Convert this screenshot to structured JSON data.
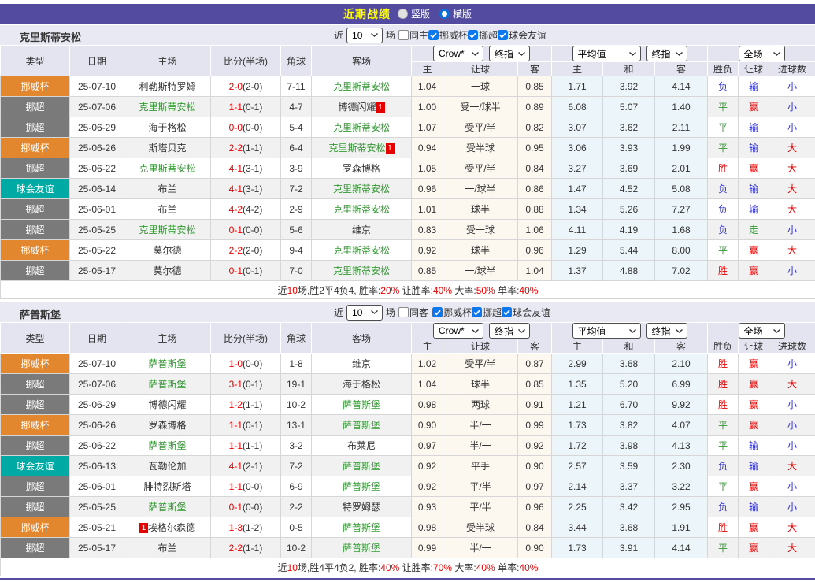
{
  "page": {
    "title": "近期战绩",
    "layout_options": [
      {
        "label": "竖版",
        "selected": false
      },
      {
        "label": "横版",
        "selected": true
      }
    ]
  },
  "filter": {
    "near": "近",
    "rounds": "10",
    "unit": "场"
  },
  "header": {
    "type": "类型",
    "date": "日期",
    "home": "主场",
    "score": "比分(半场)",
    "corners": "角球",
    "away": "客场",
    "group1_selects": [
      "Crow*",
      "终指"
    ],
    "group1_cols": [
      "主",
      "让球",
      "客"
    ],
    "group2_selects": [
      "平均值",
      "终指"
    ],
    "group2_cols": [
      "主",
      "和",
      "客"
    ],
    "group3_select": "全场",
    "group3_cols": [
      "胜负",
      "让球",
      "进球数"
    ]
  },
  "type_colors": {
    "挪威杯": "#e2872e",
    "挪超": "#7a7a7a",
    "球会友谊": "#00aaa4"
  },
  "result_colors": {
    "胜": "r-red",
    "平": "r-green",
    "负": "r-blue",
    "赢": "r-red",
    "输": "r-blue",
    "走": "r-green",
    "大": "r-red",
    "小": "r-blue"
  },
  "select_widths": {
    "rounds-select": 46,
    "bookmaker-select": 64,
    "index-type-select": 52,
    "average-select": 87,
    "index-type-select-2": 52,
    "period-select": 59
  },
  "tables": [
    {
      "team": "克里斯蒂安松",
      "same_option": "同主",
      "same_checked": false,
      "same_gap": false,
      "competitions": [
        {
          "label": "挪威杯",
          "checked": true
        },
        {
          "label": "挪超",
          "checked": true
        },
        {
          "label": "球会友谊",
          "checked": true
        }
      ],
      "rows": [
        {
          "type": "挪威杯",
          "date": "25-07-10",
          "home": "利勒斯特罗姆",
          "home_self": false,
          "home_badge": "",
          "score": "2-0",
          "half": "(2-0)",
          "corners": "7-11",
          "away": "克里斯蒂安松",
          "away_self": true,
          "away_badge": "",
          "odds": [
            "1.04",
            "一球",
            "0.85"
          ],
          "avg": [
            "1.71",
            "3.92",
            "4.14"
          ],
          "results": [
            "负",
            "输",
            "小"
          ]
        },
        {
          "type": "挪超",
          "date": "25-07-06",
          "home": "克里斯蒂安松",
          "home_self": true,
          "home_badge": "",
          "score": "1-1",
          "half": "(0-1)",
          "corners": "4-7",
          "away": "博德闪耀",
          "away_self": false,
          "away_badge": "1",
          "odds": [
            "1.00",
            "受一/球半",
            "0.89"
          ],
          "avg": [
            "6.08",
            "5.07",
            "1.40"
          ],
          "results": [
            "平",
            "赢",
            "小"
          ]
        },
        {
          "type": "挪超",
          "date": "25-06-29",
          "home": "海于格松",
          "home_self": false,
          "home_badge": "",
          "score": "0-0",
          "half": "(0-0)",
          "corners": "5-4",
          "away": "克里斯蒂安松",
          "away_self": true,
          "away_badge": "",
          "odds": [
            "1.07",
            "受平/半",
            "0.82"
          ],
          "avg": [
            "3.07",
            "3.62",
            "2.11"
          ],
          "results": [
            "平",
            "输",
            "小"
          ]
        },
        {
          "type": "挪威杯",
          "date": "25-06-26",
          "home": "斯塔贝克",
          "home_self": false,
          "home_badge": "",
          "score": "2-2",
          "half": "(1-1)",
          "corners": "6-4",
          "away": "克里斯蒂安松",
          "away_self": true,
          "away_badge": "1",
          "odds": [
            "0.94",
            "受半球",
            "0.95"
          ],
          "avg": [
            "3.06",
            "3.93",
            "1.99"
          ],
          "results": [
            "平",
            "输",
            "大"
          ]
        },
        {
          "type": "挪超",
          "date": "25-06-22",
          "home": "克里斯蒂安松",
          "home_self": true,
          "home_badge": "",
          "score": "4-1",
          "half": "(3-1)",
          "corners": "3-9",
          "away": "罗森博格",
          "away_self": false,
          "away_badge": "",
          "odds": [
            "1.05",
            "受平/半",
            "0.84"
          ],
          "avg": [
            "3.27",
            "3.69",
            "2.01"
          ],
          "results": [
            "胜",
            "赢",
            "大"
          ]
        },
        {
          "type": "球会友谊",
          "date": "25-06-14",
          "home": "布兰",
          "home_self": false,
          "home_badge": "",
          "score": "4-1",
          "half": "(3-1)",
          "corners": "7-2",
          "away": "克里斯蒂安松",
          "away_self": true,
          "away_badge": "",
          "odds": [
            "0.96",
            "一/球半",
            "0.86"
          ],
          "avg": [
            "1.47",
            "4.52",
            "5.08"
          ],
          "results": [
            "负",
            "输",
            "大"
          ]
        },
        {
          "type": "挪超",
          "date": "25-06-01",
          "home": "布兰",
          "home_self": false,
          "home_badge": "",
          "score": "4-2",
          "half": "(4-2)",
          "corners": "2-9",
          "away": "克里斯蒂安松",
          "away_self": true,
          "away_badge": "",
          "odds": [
            "1.01",
            "球半",
            "0.88"
          ],
          "avg": [
            "1.34",
            "5.26",
            "7.27"
          ],
          "results": [
            "负",
            "输",
            "大"
          ]
        },
        {
          "type": "挪超",
          "date": "25-05-25",
          "home": "克里斯蒂安松",
          "home_self": true,
          "home_badge": "",
          "score": "0-1",
          "half": "(0-0)",
          "corners": "5-6",
          "away": "维京",
          "away_self": false,
          "away_badge": "",
          "odds": [
            "0.83",
            "受一球",
            "1.06"
          ],
          "avg": [
            "4.11",
            "4.19",
            "1.68"
          ],
          "results": [
            "负",
            "走",
            "小"
          ]
        },
        {
          "type": "挪威杯",
          "date": "25-05-22",
          "home": "莫尔德",
          "home_self": false,
          "home_badge": "",
          "score": "2-2",
          "half": "(2-0)",
          "corners": "9-4",
          "away": "克里斯蒂安松",
          "away_self": true,
          "away_badge": "",
          "odds": [
            "0.92",
            "球半",
            "0.96"
          ],
          "avg": [
            "1.29",
            "5.44",
            "8.00"
          ],
          "results": [
            "平",
            "赢",
            "大"
          ]
        },
        {
          "type": "挪超",
          "date": "25-05-17",
          "home": "莫尔德",
          "home_self": false,
          "home_badge": "",
          "score": "0-1",
          "half": "(0-1)",
          "corners": "7-0",
          "away": "克里斯蒂安松",
          "away_self": true,
          "away_badge": "",
          "odds": [
            "0.85",
            "一/球半",
            "1.04"
          ],
          "avg": [
            "1.37",
            "4.88",
            "7.02"
          ],
          "results": [
            "胜",
            "赢",
            "小"
          ]
        }
      ],
      "summary": [
        [
          "近",
          0
        ],
        [
          "10",
          1
        ],
        [
          "场,胜2平4负4, 胜率:",
          0
        ],
        [
          "20%",
          1
        ],
        [
          " 让胜率:",
          0
        ],
        [
          "40%",
          1
        ],
        [
          " 大率:",
          0
        ],
        [
          "50%",
          1
        ],
        [
          " 单率:",
          0
        ],
        [
          "40%",
          1
        ]
      ]
    },
    {
      "team": "萨普斯堡",
      "same_option": "同客",
      "same_checked": false,
      "same_gap": true,
      "competitions": [
        {
          "label": "挪威杯",
          "checked": true
        },
        {
          "label": "挪超",
          "checked": true
        },
        {
          "label": "球会友谊",
          "checked": true
        }
      ],
      "rows": [
        {
          "type": "挪威杯",
          "date": "25-07-10",
          "home": "萨普斯堡",
          "home_self": true,
          "home_badge": "",
          "score": "1-0",
          "half": "(0-0)",
          "corners": "1-8",
          "away": "维京",
          "away_self": false,
          "away_badge": "",
          "odds": [
            "1.02",
            "受平/半",
            "0.87"
          ],
          "avg": [
            "2.99",
            "3.68",
            "2.10"
          ],
          "results": [
            "胜",
            "赢",
            "小"
          ]
        },
        {
          "type": "挪超",
          "date": "25-07-06",
          "home": "萨普斯堡",
          "home_self": true,
          "home_badge": "",
          "score": "3-1",
          "half": "(0-1)",
          "corners": "19-1",
          "away": "海于格松",
          "away_self": false,
          "away_badge": "",
          "odds": [
            "1.04",
            "球半",
            "0.85"
          ],
          "avg": [
            "1.35",
            "5.20",
            "6.99"
          ],
          "results": [
            "胜",
            "赢",
            "大"
          ]
        },
        {
          "type": "挪超",
          "date": "25-06-29",
          "home": "博德闪耀",
          "home_self": false,
          "home_badge": "",
          "score": "1-2",
          "half": "(1-1)",
          "corners": "10-2",
          "away": "萨普斯堡",
          "away_self": true,
          "away_badge": "",
          "odds": [
            "0.98",
            "两球",
            "0.91"
          ],
          "avg": [
            "1.21",
            "6.70",
            "9.92"
          ],
          "results": [
            "胜",
            "赢",
            "小"
          ]
        },
        {
          "type": "挪威杯",
          "date": "25-06-26",
          "home": "罗森博格",
          "home_self": false,
          "home_badge": "",
          "score": "1-1",
          "half": "(0-1)",
          "corners": "13-1",
          "away": "萨普斯堡",
          "away_self": true,
          "away_badge": "",
          "odds": [
            "0.90",
            "半/一",
            "0.99"
          ],
          "avg": [
            "1.73",
            "3.82",
            "4.07"
          ],
          "results": [
            "平",
            "赢",
            "小"
          ]
        },
        {
          "type": "挪超",
          "date": "25-06-22",
          "home": "萨普斯堡",
          "home_self": true,
          "home_badge": "",
          "score": "1-1",
          "half": "(1-1)",
          "corners": "3-2",
          "away": "布莱尼",
          "away_self": false,
          "away_badge": "",
          "odds": [
            "0.97",
            "半/一",
            "0.92"
          ],
          "avg": [
            "1.72",
            "3.98",
            "4.13"
          ],
          "results": [
            "平",
            "输",
            "小"
          ]
        },
        {
          "type": "球会友谊",
          "date": "25-06-13",
          "home": "瓦勒伦加",
          "home_self": false,
          "home_badge": "",
          "score": "4-1",
          "half": "(2-1)",
          "corners": "7-2",
          "away": "萨普斯堡",
          "away_self": true,
          "away_badge": "",
          "odds": [
            "0.92",
            "平手",
            "0.90"
          ],
          "avg": [
            "2.57",
            "3.59",
            "2.30"
          ],
          "results": [
            "负",
            "输",
            "大"
          ]
        },
        {
          "type": "挪超",
          "date": "25-06-01",
          "home": "腓特烈斯塔",
          "home_self": false,
          "home_badge": "",
          "score": "1-1",
          "half": "(0-0)",
          "corners": "6-9",
          "away": "萨普斯堡",
          "away_self": true,
          "away_badge": "",
          "odds": [
            "0.92",
            "平/半",
            "0.97"
          ],
          "avg": [
            "2.14",
            "3.37",
            "3.22"
          ],
          "results": [
            "平",
            "赢",
            "小"
          ]
        },
        {
          "type": "挪超",
          "date": "25-05-25",
          "home": "萨普斯堡",
          "home_self": true,
          "home_badge": "",
          "score": "0-1",
          "half": "(0-0)",
          "corners": "2-2",
          "away": "特罗姆瑟",
          "away_self": false,
          "away_badge": "",
          "odds": [
            "0.93",
            "平/半",
            "0.96"
          ],
          "avg": [
            "2.25",
            "3.42",
            "2.95"
          ],
          "results": [
            "负",
            "输",
            "小"
          ]
        },
        {
          "type": "挪威杯",
          "date": "25-05-21",
          "home": "埃格尔森德",
          "home_self": false,
          "home_badge": "1",
          "home_badge_side": "left",
          "score": "1-3",
          "half": "(1-2)",
          "corners": "0-5",
          "away": "萨普斯堡",
          "away_self": true,
          "away_badge": "",
          "odds": [
            "0.98",
            "受半球",
            "0.84"
          ],
          "avg": [
            "3.44",
            "3.68",
            "1.91"
          ],
          "results": [
            "胜",
            "赢",
            "大"
          ]
        },
        {
          "type": "挪超",
          "date": "25-05-17",
          "home": "布兰",
          "home_self": false,
          "home_badge": "",
          "score": "2-2",
          "half": "(1-1)",
          "corners": "10-2",
          "away": "萨普斯堡",
          "away_self": true,
          "away_badge": "",
          "odds": [
            "0.99",
            "半/一",
            "0.90"
          ],
          "avg": [
            "1.73",
            "3.91",
            "4.14"
          ],
          "results": [
            "平",
            "赢",
            "大"
          ]
        }
      ],
      "summary": [
        [
          "近",
          0
        ],
        [
          "10",
          1
        ],
        [
          "场,胜4平4负2, 胜率:",
          0
        ],
        [
          "40%",
          1
        ],
        [
          " 让胜率:",
          0
        ],
        [
          "70%",
          1
        ],
        [
          " 大率:",
          0
        ],
        [
          "40%",
          1
        ],
        [
          " 单率:",
          0
        ],
        [
          "40%",
          1
        ]
      ]
    }
  ]
}
